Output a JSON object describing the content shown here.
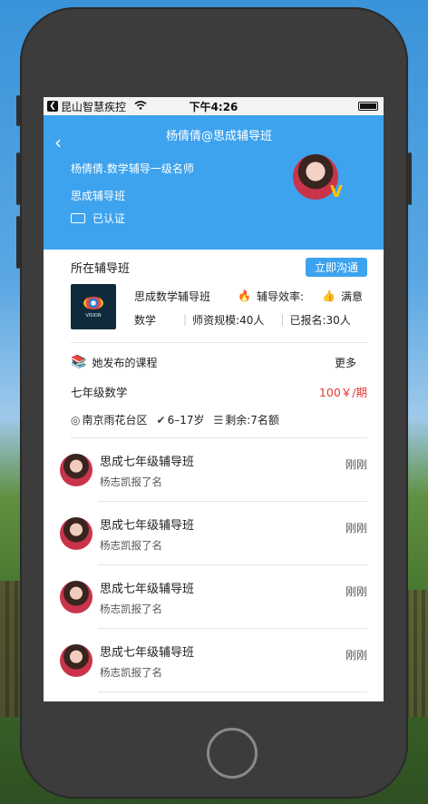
{
  "status_bar": {
    "carrier": "昆山智慧疾控",
    "time": "下午4:26"
  },
  "header": {
    "title": "杨倩倩@思成辅导班",
    "teacher_desc": "杨倩倩.数学辅导一级名师",
    "org": "思成辅导班",
    "verified": "已认证"
  },
  "class_section": {
    "title": "所在辅导班",
    "chat_button": "立即沟通",
    "name": "思成数学辅导班",
    "efficiency_label": "辅导效率:",
    "efficiency_value": "满意",
    "subject": "数学",
    "scale": "师资规模:40人",
    "enrolled": "已报名:30人"
  },
  "course_section": {
    "title": "她发布的课程",
    "more": "更多",
    "course_name": "七年级数学",
    "price": "100￥/期",
    "location": "南京雨花台区",
    "age": "6–17岁",
    "remaining": "剩余:7名额"
  },
  "enrollments": [
    {
      "title": "思成七年级辅导班",
      "sub": "杨志凯报了名",
      "time": "刚刚"
    },
    {
      "title": "思成七年级辅导班",
      "sub": "杨志凯报了名",
      "time": "刚刚"
    },
    {
      "title": "思成七年级辅导班",
      "sub": "杨志凯报了名",
      "time": "刚刚"
    },
    {
      "title": "思成七年级辅导班",
      "sub": "杨志凯报了名",
      "time": "刚刚"
    }
  ],
  "logo_text": "VISION",
  "icons": [
    "back-icon",
    "wifi-icon",
    "battery-icon",
    "fire-icon",
    "thumb-up-icon",
    "book-icon",
    "location-icon",
    "check-circle-icon",
    "list-icon"
  ]
}
